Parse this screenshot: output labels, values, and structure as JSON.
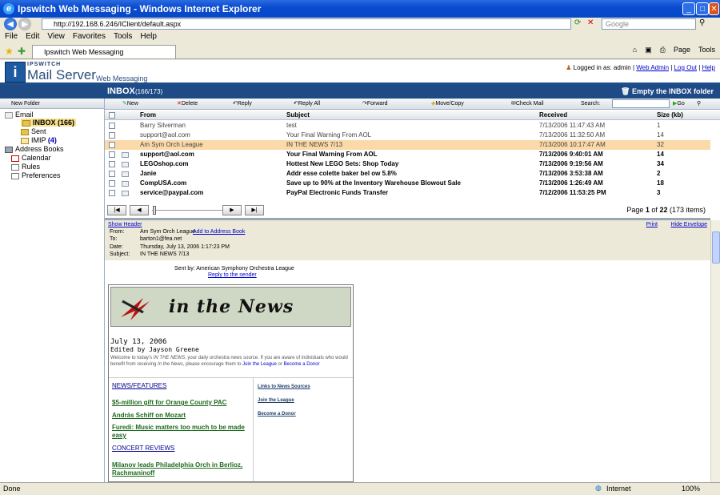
{
  "window": {
    "title": "Ipswitch Web Messaging - Windows Internet Explorer"
  },
  "browser": {
    "url": "http://192.168.6.246/IClient/default.aspx",
    "search_placeholder": "Google",
    "menu": [
      "File",
      "Edit",
      "View",
      "Favorites",
      "Tools",
      "Help"
    ],
    "tab_label": "Ipswitch Web Messaging",
    "page_label": "Page",
    "tools_label": "Tools"
  },
  "app": {
    "brand_small": "IPSWITCH",
    "brand_main": "Mail Server",
    "brand_sub": "Web Messaging",
    "logged_in_label": "Logged in as:",
    "user": "admin",
    "web_admin": "Web Admin",
    "log_out": "Log Out",
    "help": "Help"
  },
  "inbox": {
    "title": "INBOX",
    "count": "(166/173)",
    "empty_label": "Empty the INBOX folder"
  },
  "sidebar": {
    "new_folder": "New Folder",
    "items": [
      {
        "label": "Email"
      },
      {
        "label": "INBOX",
        "count": "(166)"
      },
      {
        "label": "Sent"
      },
      {
        "label": "IMIP",
        "count": "(4)"
      },
      {
        "label": "Address Books"
      },
      {
        "label": "Calendar"
      },
      {
        "label": "Rules"
      },
      {
        "label": "Preferences"
      }
    ]
  },
  "toolbar": {
    "new": "New",
    "delete": "Delete",
    "reply": "Reply",
    "reply_all": "Reply All",
    "forward": "Forward",
    "move_copy": "Move/Copy",
    "check_mail": "Check Mail",
    "search": "Search:",
    "go": "Go"
  },
  "columns": {
    "from": "From",
    "subject": "Subject",
    "received": "Received",
    "size": "Size (kb)"
  },
  "messages": [
    {
      "from": "Barry Silverman",
      "subject": "test",
      "received": "7/13/2006 11:47:43 AM",
      "size": "1",
      "unread": false
    },
    {
      "from": "support@aol.com",
      "subject": "Your Final Warning From AOL",
      "received": "7/13/2006 11:32:50 AM",
      "size": "14",
      "unread": false
    },
    {
      "from": "Am Sym Orch League",
      "subject": "IN THE NEWS 7/13",
      "received": "7/13/2006 10:17:47 AM",
      "size": "32",
      "unread": false,
      "selected": true
    },
    {
      "from": "support@aol.com",
      "subject": "Your Final Warning From AOL",
      "received": "7/13/2006 9:40:01 AM",
      "size": "14",
      "unread": true
    },
    {
      "from": "LEGOshop.com",
      "subject": "Hottest New LEGO Sets: Shop Today",
      "received": "7/13/2006 9:19:56 AM",
      "size": "34",
      "unread": true
    },
    {
      "from": "Janie",
      "subject": "Addr esse colette baker bel ow 5.8%",
      "received": "7/13/2006 3:53:38 AM",
      "size": "2",
      "unread": true
    },
    {
      "from": "CompUSA.com",
      "subject": "Save up to 90% at the Inventory Warehouse Blowout Sale",
      "received": "7/13/2006 1:26:49 AM",
      "size": "18",
      "unread": true
    },
    {
      "from": "service@paypal.com",
      "subject": "PayPal Electronic Funds Transfer",
      "received": "7/12/2006 11:53:25 PM",
      "size": "3",
      "unread": true
    }
  ],
  "pager": {
    "page_word": "Page",
    "current": "1",
    "of_word": "of",
    "total": "22",
    "items": "(173 items)"
  },
  "preview": {
    "show_header": "Show Header",
    "print": "Print",
    "hide_envelope": "Hide Envelope",
    "from_label": "From:",
    "from": "Am Sym Orch League",
    "add_to_address_book": "Add to Address Book",
    "to_label": "To:",
    "to": "barton1@fea.net",
    "date_label": "Date:",
    "date": "Thursday, July 13, 2006 1:17:23 PM",
    "subject_label": "Subject:",
    "subject": "IN THE NEWS 7/13",
    "sent_by": "Sent by: American Symphony Orchestra League",
    "reply_to_sender": "Reply to the sender"
  },
  "newsletter": {
    "banner": "in the News",
    "date": "July 13, 2006",
    "editor": "Edited by Jayson Greene",
    "intro_1": "Welcome to today's",
    "intro_em": "IN THE NEWS",
    "intro_2": ", your daily orchestra news source. If you are aware of individuals who would benefit from receiving",
    "intro_em2": "In the News",
    "intro_3": ", please encourage them to",
    "join_link": "Join the League",
    "or_word": "or",
    "donor_link": "Become a Donor",
    "news_heading": "NEWS/FEATURES",
    "stories": [
      "$5-million gift for Orange County PAC",
      "András Schiff on Mozart",
      "Furedi: Music matters too much to be made easy"
    ],
    "concert_heading": "CONCERT REVIEWS",
    "concert_stories": [
      "Milanov leads Philadelphia Orch in Berlioz, Rachmaninoff"
    ],
    "side_links": [
      "Links to News Sources",
      "Join the League",
      "Become a Donor"
    ]
  },
  "status": {
    "text": "Done",
    "zone": "Internet",
    "zoom": "100%"
  }
}
